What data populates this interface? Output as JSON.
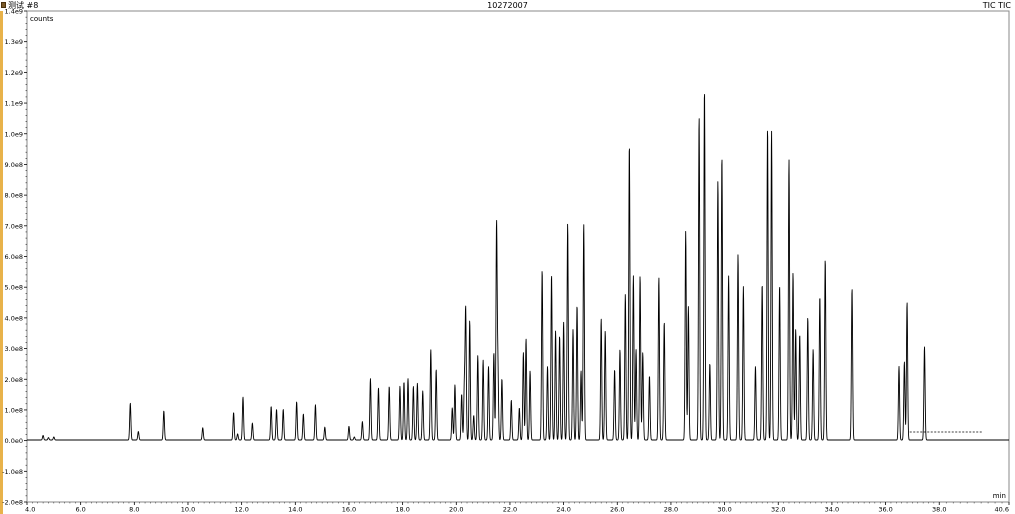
{
  "window": {
    "title_left": "测试 #8",
    "title_center": "10272007",
    "title_right": "TIC TIC"
  },
  "chart_data": {
    "type": "line",
    "title": "10272007",
    "xlabel": "min",
    "ylabel": "counts",
    "xlim": [
      4.0,
      40.6
    ],
    "ylim": [
      -200000000.0,
      1400000000.0
    ],
    "xticks": [
      4.0,
      6.0,
      8.0,
      10.0,
      12.0,
      14.0,
      16.0,
      18.0,
      20.0,
      22.0,
      24.0,
      26.0,
      28.0,
      30.0,
      32.0,
      34.0,
      36.0,
      38.0,
      40.6
    ],
    "xtick_labels": [
      "4.0",
      "6.0",
      "8.0",
      "10.0",
      "12.0",
      "14.0",
      "16.0",
      "18.0",
      "20.0",
      "22.0",
      "24.0",
      "26.0",
      "28.0",
      "30.0",
      "32.0",
      "34.0",
      "36.0",
      "38.0",
      "40.6"
    ],
    "yticks": [
      -200000000.0,
      -100000000.0,
      0,
      100000000.0,
      200000000.0,
      300000000.0,
      400000000.0,
      500000000.0,
      600000000.0,
      700000000.0,
      800000000.0,
      900000000.0,
      1000000000.0,
      1100000000.0,
      1200000000.0,
      1300000000.0,
      1400000000.0
    ],
    "ytick_labels": [
      "-2.0e8",
      "-1.0e8",
      "0.0e0",
      "1.0e8",
      "2.0e8",
      "3.0e8",
      "4.0e8",
      "5.0e8",
      "6.0e8",
      "7.0e8",
      "8.0e8",
      "9.0e8",
      "1.0e9",
      "1.1e9",
      "1.2e9",
      "1.3e9",
      "1.4e9"
    ],
    "baseline": 2000000.0,
    "series": [
      {
        "color": "#000000",
        "peaks": [
          [
            4.6,
            15000000.0
          ],
          [
            4.8,
            8000000.0
          ],
          [
            5.0,
            10000000.0
          ],
          [
            7.85,
            120000000.0
          ],
          [
            8.15,
            28000000.0
          ],
          [
            9.1,
            95000000.0
          ],
          [
            10.55,
            40000000.0
          ],
          [
            11.7,
            90000000.0
          ],
          [
            11.85,
            20000000.0
          ],
          [
            12.05,
            140000000.0
          ],
          [
            12.4,
            55000000.0
          ],
          [
            13.1,
            110000000.0
          ],
          [
            13.3,
            100000000.0
          ],
          [
            13.55,
            100000000.0
          ],
          [
            14.05,
            125000000.0
          ],
          [
            14.3,
            85000000.0
          ],
          [
            14.75,
            115000000.0
          ],
          [
            15.1,
            42000000.0
          ],
          [
            16.0,
            45000000.0
          ],
          [
            16.2,
            10000000.0
          ],
          [
            16.5,
            60000000.0
          ],
          [
            16.8,
            200000000.0
          ],
          [
            17.1,
            170000000.0
          ],
          [
            17.5,
            175000000.0
          ],
          [
            17.9,
            175000000.0
          ],
          [
            18.05,
            190000000.0
          ],
          [
            18.2,
            200000000.0
          ],
          [
            18.4,
            175000000.0
          ],
          [
            18.55,
            185000000.0
          ],
          [
            18.75,
            160000000.0
          ],
          [
            19.05,
            295000000.0
          ],
          [
            19.25,
            230000000.0
          ],
          [
            19.85,
            105000000.0
          ],
          [
            19.95,
            180000000.0
          ],
          [
            20.2,
            150000000.0
          ],
          [
            20.3,
            175000000.0
          ],
          [
            20.35,
            425000000.0
          ],
          [
            20.5,
            390000000.0
          ],
          [
            20.65,
            80000000.0
          ],
          [
            20.8,
            275000000.0
          ],
          [
            21.0,
            260000000.0
          ],
          [
            21.2,
            240000000.0
          ],
          [
            21.4,
            285000000.0
          ],
          [
            21.5,
            700000000.0
          ],
          [
            21.55,
            240000000.0
          ],
          [
            21.7,
            200000000.0
          ],
          [
            22.05,
            130000000.0
          ],
          [
            22.35,
            105000000.0
          ],
          [
            22.5,
            285000000.0
          ],
          [
            22.6,
            330000000.0
          ],
          [
            22.75,
            225000000.0
          ],
          [
            23.2,
            555000000.0
          ],
          [
            23.4,
            240000000.0
          ],
          [
            23.55,
            540000000.0
          ],
          [
            23.7,
            355000000.0
          ],
          [
            23.85,
            340000000.0
          ],
          [
            24.0,
            385000000.0
          ],
          [
            24.15,
            705000000.0
          ],
          [
            24.35,
            360000000.0
          ],
          [
            24.5,
            440000000.0
          ],
          [
            24.65,
            225000000.0
          ],
          [
            24.75,
            705000000.0
          ],
          [
            25.4,
            395000000.0
          ],
          [
            25.55,
            355000000.0
          ],
          [
            25.9,
            230000000.0
          ],
          [
            26.1,
            295000000.0
          ],
          [
            26.3,
            475000000.0
          ],
          [
            26.45,
            965000000.0
          ],
          [
            26.6,
            535000000.0
          ],
          [
            26.7,
            295000000.0
          ],
          [
            26.85,
            535000000.0
          ],
          [
            26.95,
            285000000.0
          ],
          [
            27.2,
            210000000.0
          ],
          [
            27.55,
            530000000.0
          ],
          [
            27.75,
            385000000.0
          ],
          [
            28.55,
            680000000.0
          ],
          [
            28.65,
            435000000.0
          ],
          [
            29.05,
            1055000000.0
          ],
          [
            29.25,
            1145000000.0
          ],
          [
            29.45,
            250000000.0
          ],
          [
            29.75,
            845000000.0
          ],
          [
            29.9,
            925000000.0
          ],
          [
            30.15,
            535000000.0
          ],
          [
            30.5,
            605000000.0
          ],
          [
            30.7,
            500000000.0
          ],
          [
            31.15,
            240000000.0
          ],
          [
            31.4,
            510000000.0
          ],
          [
            31.6,
            1020000000.0
          ],
          [
            31.75,
            1010000000.0
          ],
          [
            32.05,
            505000000.0
          ],
          [
            32.4,
            915000000.0
          ],
          [
            32.55,
            545000000.0
          ],
          [
            32.65,
            360000000.0
          ],
          [
            32.8,
            345000000.0
          ],
          [
            33.1,
            400000000.0
          ],
          [
            33.3,
            295000000.0
          ],
          [
            33.55,
            470000000.0
          ],
          [
            33.75,
            590000000.0
          ],
          [
            34.75,
            495000000.0
          ],
          [
            36.5,
            240000000.0
          ],
          [
            36.7,
            255000000.0
          ],
          [
            36.8,
            450000000.0
          ],
          [
            37.45,
            305000000.0
          ]
        ]
      }
    ],
    "annotation_line": {
      "x_start": 36.9,
      "x_end": 39.6,
      "y": 28000000.0,
      "style": "dashed"
    },
    "grid": false
  }
}
